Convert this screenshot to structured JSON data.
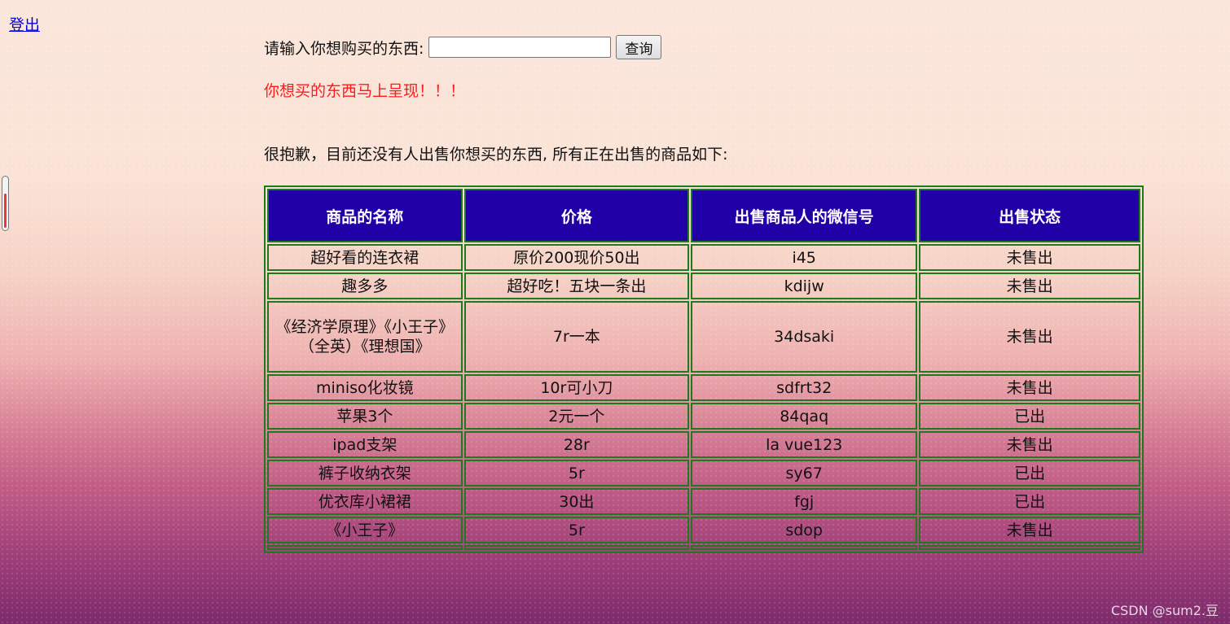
{
  "header": {
    "logout_label": "登出"
  },
  "search": {
    "label": "请输入你想购买的东西:",
    "value": "",
    "placeholder": "",
    "button_label": "查询"
  },
  "promo_text": "你想买的东西马上呈现！！！",
  "notice_text": "很抱歉，目前还没有人出售你想买的东西, 所有正在出售的商品如下:",
  "table": {
    "headers": {
      "name": "商品的名称",
      "price": "价格",
      "wechat": "出售商品人的微信号",
      "status": "出售状态"
    },
    "rows": [
      {
        "name": "超好看的连衣裙",
        "price": "原价200现价50出",
        "wechat": "i45",
        "status": "未售出"
      },
      {
        "name": "趣多多",
        "price": "超好吃！五块一条出",
        "wechat": "kdijw",
        "status": "未售出"
      },
      {
        "name": "《经济学原理》《小王子》（全英）《理想国》",
        "price": "7r一本",
        "wechat": "34dsaki",
        "status": "未售出"
      },
      {
        "name": "miniso化妆镜",
        "price": "10r可小刀",
        "wechat": "sdfrt32",
        "status": "未售出"
      },
      {
        "name": "苹果3个",
        "price": "2元一个",
        "wechat": "84qaq",
        "status": "已出"
      },
      {
        "name": "ipad支架",
        "price": "28r",
        "wechat": "la vue123",
        "status": "未售出"
      },
      {
        "name": "裤子收纳衣架",
        "price": "5r",
        "wechat": "sy67",
        "status": "已出"
      },
      {
        "name": "优衣库小裙裙",
        "price": "30出",
        "wechat": "fgj",
        "status": "已出"
      },
      {
        "name": "《小王子》",
        "price": "5r",
        "wechat": "sdop",
        "status": "未售出"
      }
    ]
  },
  "edge_slider": {
    "level": 0.7,
    "fill_color": "#e23a3a"
  },
  "colors": {
    "header_bg": "#2200a8",
    "border": "#1e7a1e",
    "promo": "#ff1a1a",
    "link": "#0000ee"
  },
  "watermark": "CSDN @sum2.豆"
}
